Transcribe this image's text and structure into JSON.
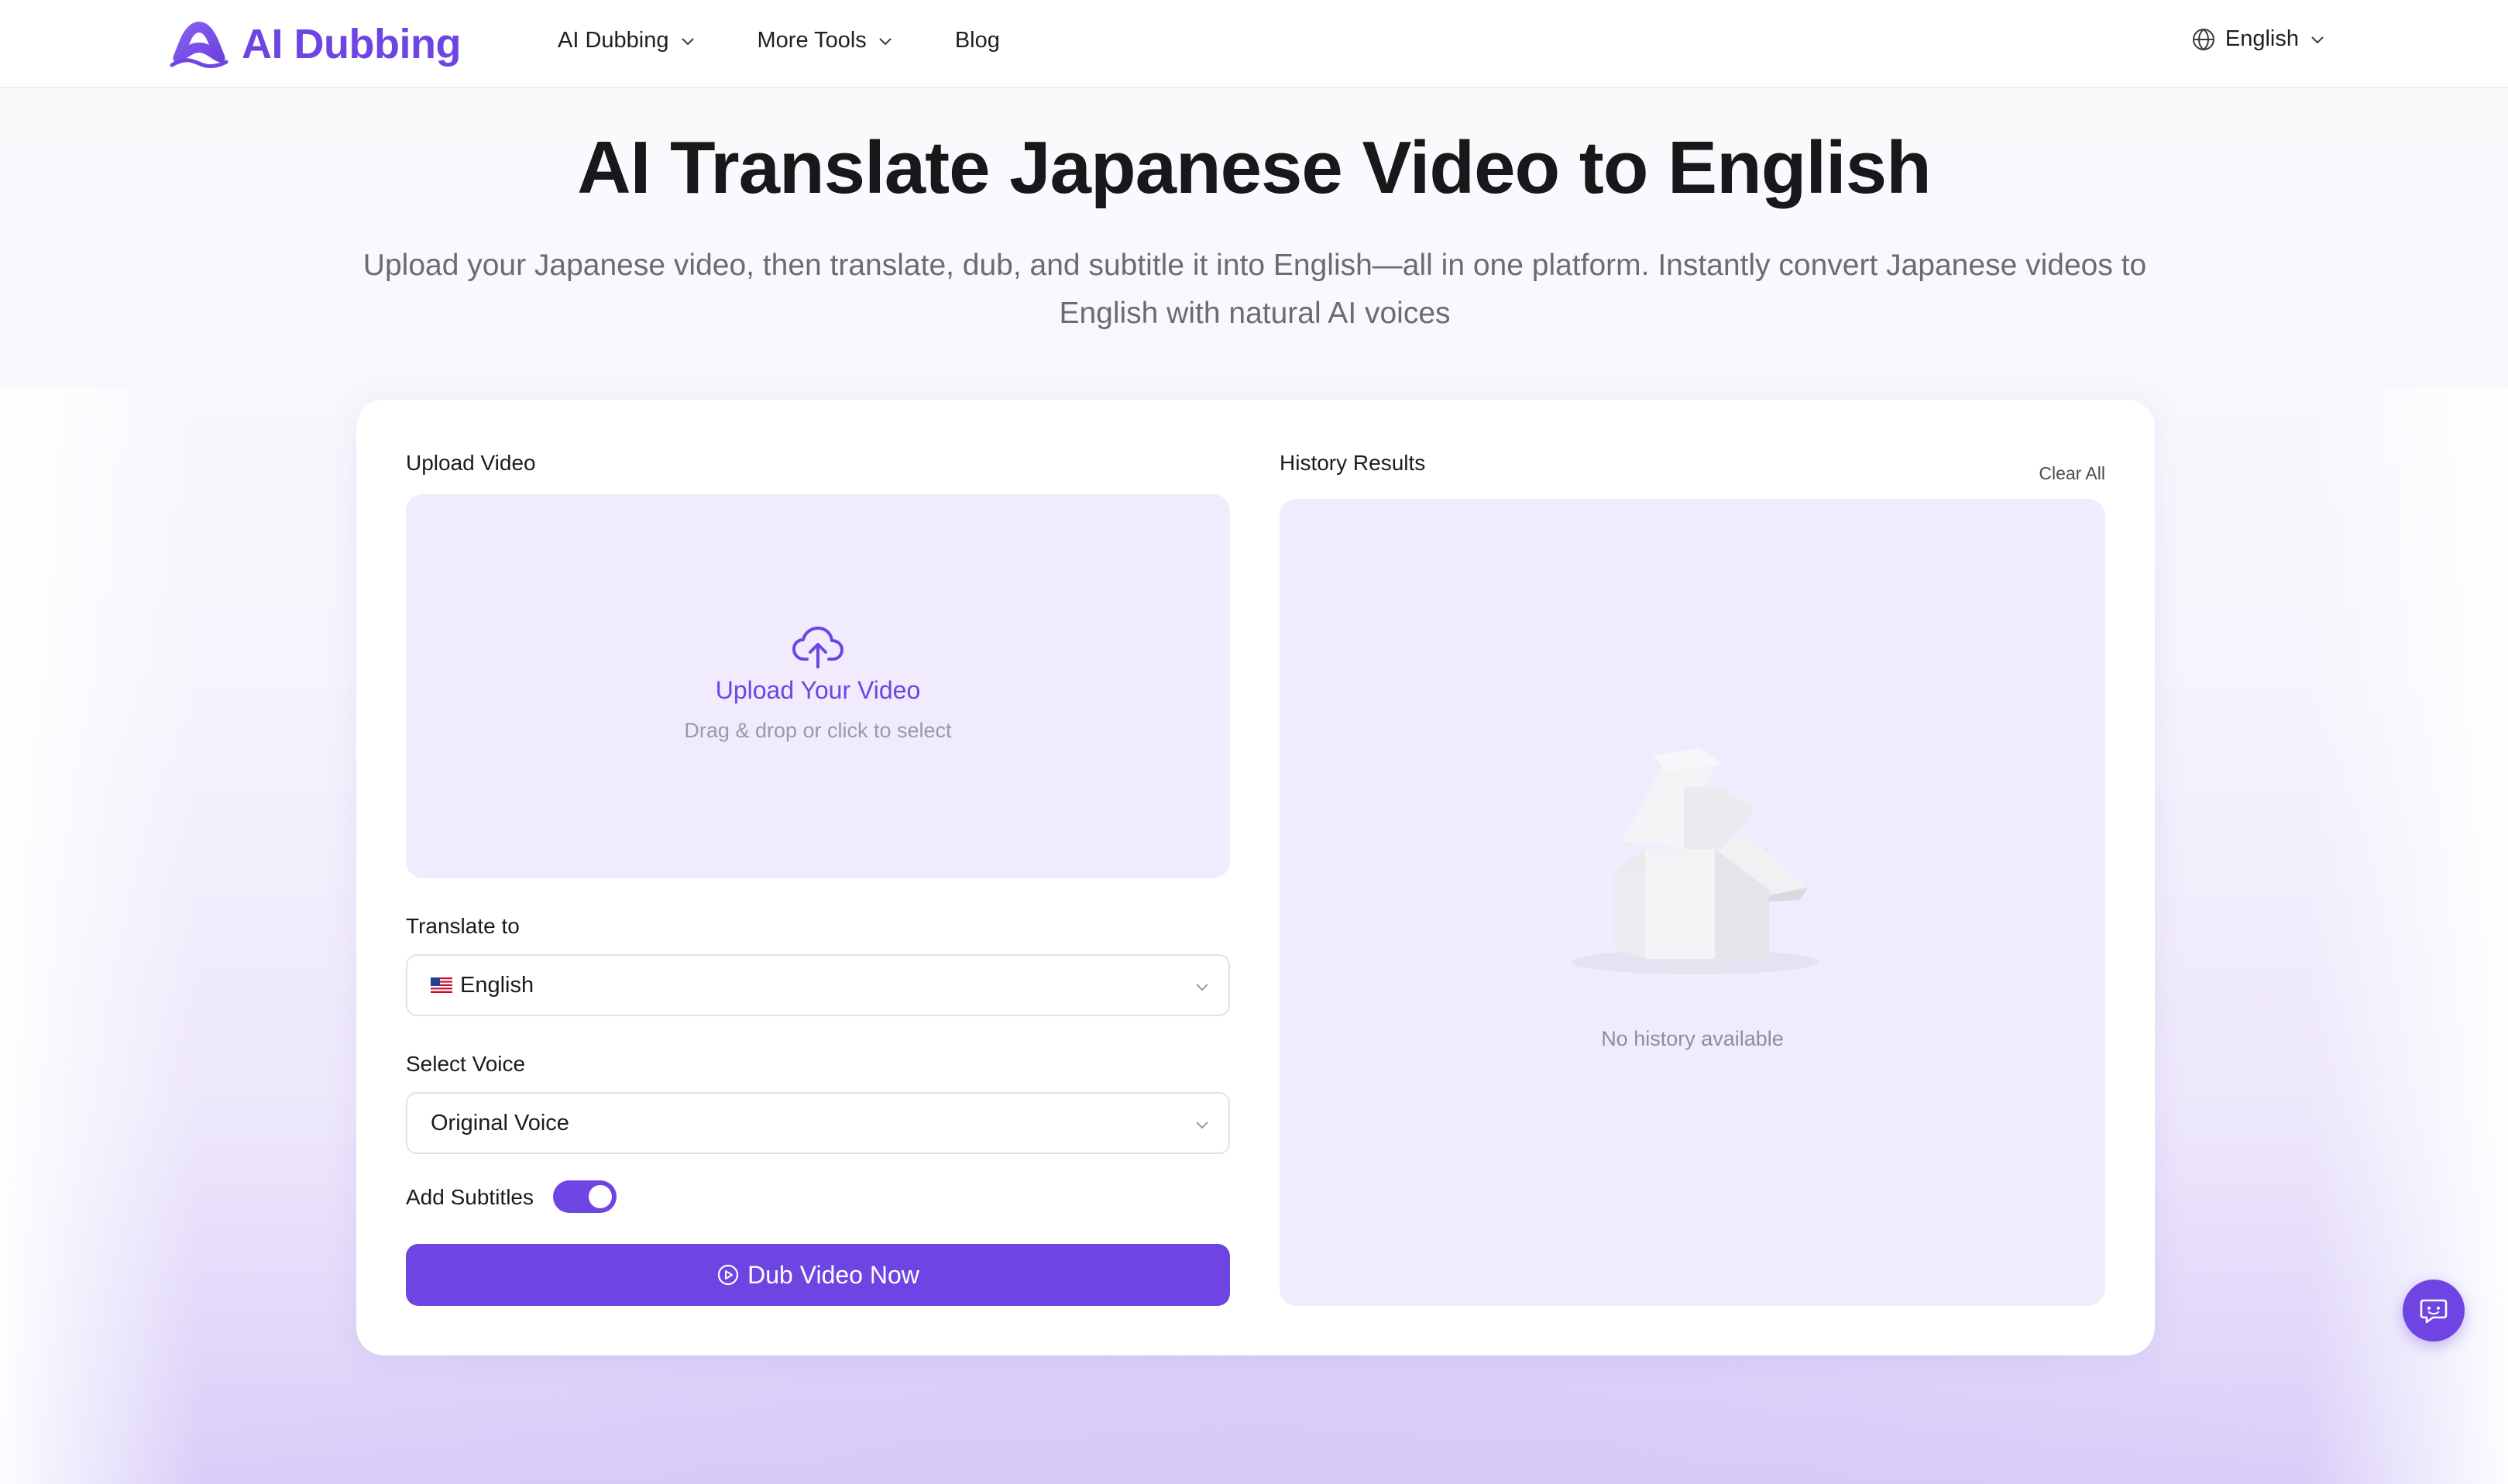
{
  "brand": {
    "name": "AI Dubbing",
    "color": "#6e45e2"
  },
  "nav": {
    "items": [
      {
        "label": "AI Dubbing",
        "has_dropdown": true
      },
      {
        "label": "More Tools",
        "has_dropdown": true
      },
      {
        "label": "Blog",
        "has_dropdown": false
      }
    ],
    "language": "English"
  },
  "hero": {
    "title": "AI Translate Japanese Video to English",
    "subtitle_line1": "Upload your Japanese video, then translate, dub, and subtitle it into English—all in one platform. Instantly convert Japanese videos to",
    "subtitle_line2": "English with natural AI voices"
  },
  "upload": {
    "section_label": "Upload Video",
    "title": "Upload Your Video",
    "hint": "Drag & drop or click to select",
    "icon": "cloud-upload-icon"
  },
  "translate": {
    "label": "Translate to",
    "selected": "English",
    "flag": "us-flag"
  },
  "voice": {
    "label": "Select Voice",
    "selected": "Original Voice"
  },
  "subtitles": {
    "label": "Add Subtitles",
    "enabled": true
  },
  "action": {
    "button_label": "Dub Video Now",
    "icon": "play-circle-icon"
  },
  "history": {
    "label": "History Results",
    "clear_label": "Clear All",
    "empty_text": "No history available"
  },
  "chat": {
    "icon": "chat-icon"
  }
}
